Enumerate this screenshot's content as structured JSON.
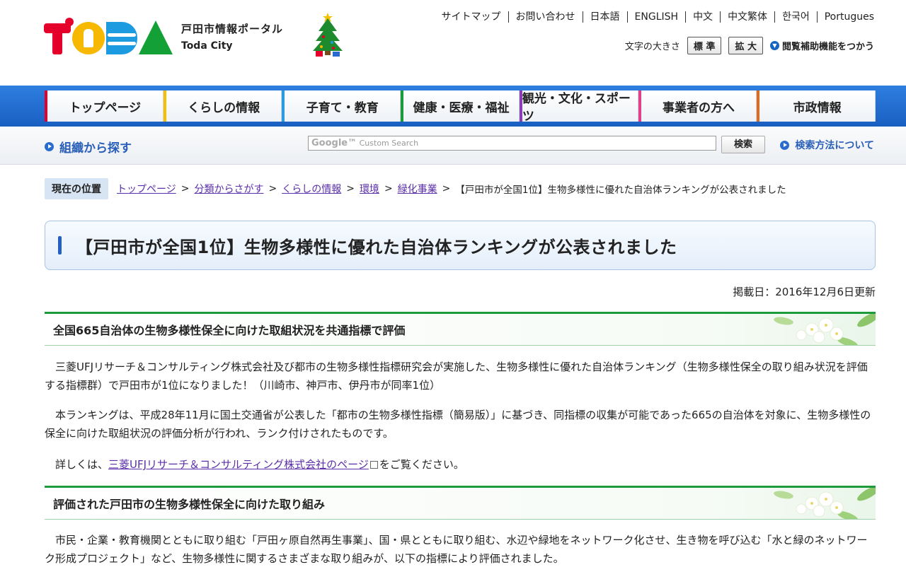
{
  "header": {
    "logo_text": "TODA",
    "logo_jp": "戸田市情報ポータル",
    "logo_en": "Toda City",
    "util_links": [
      "サイトマップ",
      "お問い合わせ",
      "日本語",
      "ENGLISH",
      "中文",
      "中文繁体",
      "한국어",
      "Portugues"
    ],
    "size_label": "文字の大きさ",
    "size_standard": "標 準",
    "size_large": "拡 大",
    "assist_label": "閲覧補助機能をつかう"
  },
  "nav": {
    "items": [
      "トップページ",
      "くらしの情報",
      "子育て・教育",
      "健康・医療・福祉",
      "観光・文化・スポーツ",
      "事業者の方へ",
      "市政情報"
    ],
    "colors": [
      "#e4002b",
      "#f6c000",
      "#2d9be0",
      "#1c9b3c",
      "#8b3fb2",
      "#e0418a",
      "#e06a20"
    ]
  },
  "search": {
    "org_search": "組織から探す",
    "placeholder_brand": "Google™",
    "placeholder": "Custom Search",
    "button": "検索",
    "help": "検索方法について"
  },
  "breadcrumb": {
    "label": "現在の位置",
    "links": [
      "トップページ",
      "分類からさがす",
      "くらしの情報",
      "環境",
      "緑化事業"
    ],
    "current": "【戸田市が全国1位】生物多様性に優れた自治体ランキングが公表されました",
    "separator": ">"
  },
  "page": {
    "title": "【戸田市が全国1位】生物多様性に優れた自治体ランキングが公表されました",
    "date": "掲載日：2016年12月6日更新",
    "section1_heading": "全国665自治体の生物多様性保全に向けた取組状況を共通指標で評価",
    "p1": "三菱UFJリサーチ＆コンサルティング株式会社及び都市の生物多様性指標研究会が実施した、生物多様性に優れた自治体ランキング（生物多様性保全の取り組み状況を評価する指標群）で戸田市が1位になりました！（川崎市、神戸市、伊丹市が同率1位）",
    "p2": "本ランキングは、平成28年11月に国土交通省が公表した「都市の生物多様性指標（簡易版）」に基づき、同指標の収集が可能であった665の自治体を対象に、生物多様性の保全に向けた取組状況の評価分析が行われ、ランク付けされたものです。",
    "p3_prefix": "詳しくは、",
    "p3_link": "三菱UFJリサーチ＆コンサルティング株式会社のページ",
    "p3_suffix": "をご覧ください。",
    "section2_heading": "評価された戸田市の生物多様性保全に向けた取り組み",
    "p4": "市民・企業・教育機関とともに取り組む「戸田ヶ原自然再生事業」、国・県とともに取り組む、水辺や緑地をネットワーク化させ、生き物を呼び込む「水と緑のネットワーク形成プロジェクト」など、生物多様性に関するさまざまな取り組みが、以下の指標により評価されました。"
  }
}
